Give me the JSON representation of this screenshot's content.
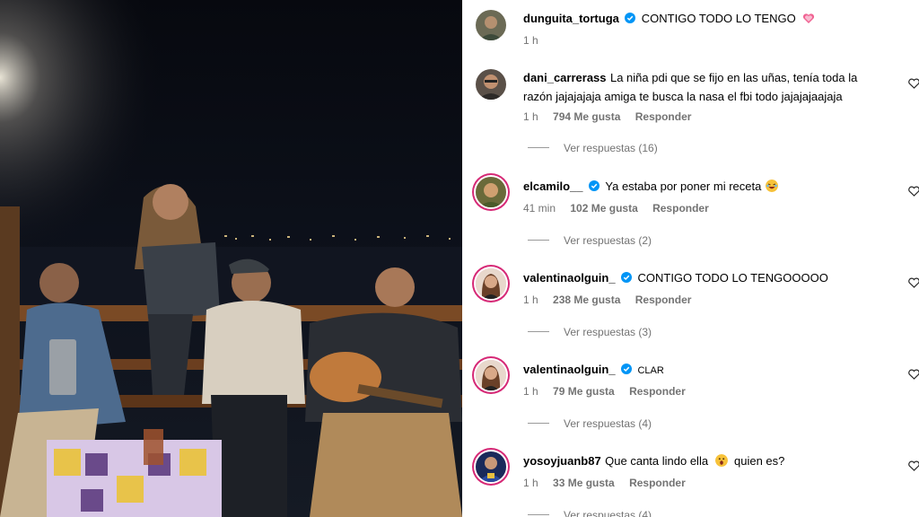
{
  "post": {
    "username": "dunguita_tortuga",
    "caption": "CONTIGO TODO LO TENGO",
    "caption_emoji": "heart-emoji",
    "time": "1 h"
  },
  "comments": [
    {
      "username": "dani_carrerass",
      "verified": false,
      "text": "La niña pdi que se fijo en las uñas, tenía toda la razón jajajajaja amiga te busca la nasa el fbi todo jajajajaajaja",
      "time": "1 h",
      "likes": "794 Me gusta",
      "reply": "Responder",
      "view_replies": "Ver respuestas (16)"
    },
    {
      "username": "elcamilo__",
      "verified": true,
      "text": "Ya estaba por poner mi receta",
      "emoji": "laughing-emoji",
      "time": "41 min",
      "likes": "102 Me gusta",
      "reply": "Responder",
      "view_replies": "Ver respuestas (2)"
    },
    {
      "username": "valentinaolguin_",
      "verified": true,
      "text": "CONTIGO TODO LO TENGOOOOO",
      "time": "1 h",
      "likes": "238 Me gusta",
      "reply": "Responder",
      "view_replies": "Ver respuestas (3)"
    },
    {
      "username": "valentinaolguin_",
      "verified": true,
      "text": "CLAR",
      "time": "1 h",
      "likes": "79 Me gusta",
      "reply": "Responder",
      "view_replies": "Ver respuestas (4)"
    },
    {
      "username": "yosoyjuanb87",
      "verified": false,
      "text": "Que canta lindo ella",
      "emoji": "surprised-emoji",
      "text_after": "quien es?",
      "time": "1 h",
      "likes": "33 Me gusta",
      "reply": "Responder",
      "view_replies": "Ver respuestas (4)"
    }
  ],
  "colors": {
    "verified": "#0095f6",
    "meta": "#737373",
    "story_ring": "#d62976"
  }
}
